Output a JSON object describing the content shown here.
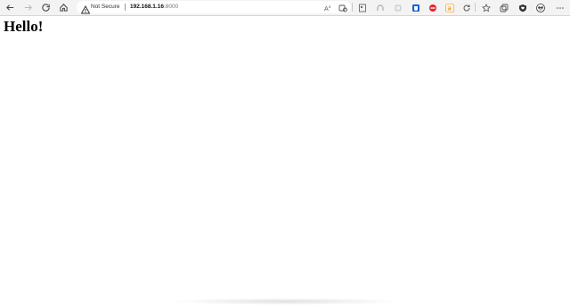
{
  "browser": {
    "toolbar": {
      "back_icon": "arrow-left-icon",
      "forward_icon": "arrow-right-icon",
      "refresh_icon": "refresh-icon",
      "home_icon": "home-icon"
    },
    "address_bar": {
      "security_label": "Not Secure",
      "url_host": "192.168.1.16",
      "url_port": ":8000"
    },
    "icons": [
      "read-aloud-icon",
      "tracking-prevention-icon",
      "reader-mode-icon",
      "extension-gray-icon",
      "extension-gray-2-icon",
      "bitwarden-icon",
      "adblock-icon",
      "amazon-icon",
      "sync-icon",
      "favorites-icon",
      "collections-icon",
      "shield-heart-icon",
      "profile-icon"
    ],
    "colors": {
      "toolbar_bg": "#f3f3f3",
      "bitwarden": "#175ddc",
      "adblock": "#e8262c",
      "amazon": "#ff9900"
    }
  },
  "page": {
    "heading": "Hello!"
  }
}
